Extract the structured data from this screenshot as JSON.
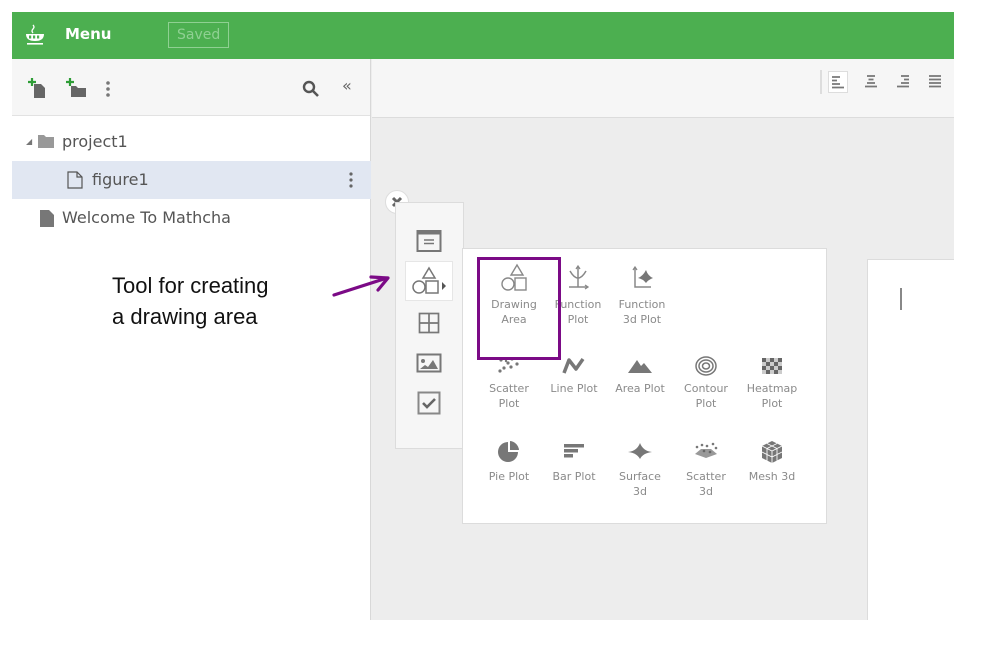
{
  "topbar": {
    "logo_icon": "coffee-cup-icon",
    "menu_label": "Menu",
    "saved_label": "Saved",
    "accent_color": "#4caf50"
  },
  "sidebar": {
    "toolbar": {
      "icons": [
        "new-file-icon",
        "new-folder-icon",
        "more-vertical-icon",
        "search-icon",
        "collapse-double-left-icon"
      ]
    },
    "tree": [
      {
        "label": "project1",
        "type": "folder",
        "expanded": true
      },
      {
        "label": "figure1",
        "type": "file",
        "selected": true
      },
      {
        "label": "Welcome To Mathcha",
        "type": "file"
      }
    ]
  },
  "editor_toolbar": {
    "align_buttons": [
      "align-left",
      "align-center",
      "align-right",
      "align-justify"
    ],
    "active": "align-left"
  },
  "insert_tools": {
    "items": [
      "text-block-icon",
      "shapes-icon",
      "table-icon",
      "image-icon",
      "checkbox-icon"
    ],
    "active": "shapes-icon"
  },
  "plot_menu": {
    "items": [
      {
        "label": "Drawing\nArea",
        "line1": "Drawing",
        "line2": "Area"
      },
      {
        "line1": "Function",
        "line2": "Plot"
      },
      {
        "line1": "Function",
        "line2": "3d Plot"
      },
      {
        "line1": "Scatter",
        "line2": "Plot"
      },
      {
        "line1": "Line Plot",
        "line2": ""
      },
      {
        "line1": "Area Plot",
        "line2": ""
      },
      {
        "line1": "Contour",
        "line2": "Plot"
      },
      {
        "line1": "Heatmap",
        "line2": "Plot"
      },
      {
        "line1": "Pie Plot",
        "line2": ""
      },
      {
        "line1": "Bar Plot",
        "line2": ""
      },
      {
        "line1": "Surface",
        "line2": "3d"
      },
      {
        "line1": "Scatter",
        "line2": "3d"
      },
      {
        "line1": "Mesh 3d",
        "line2": ""
      }
    ],
    "highlight_color": "#7b0a86"
  },
  "annotation": {
    "line1": "Tool for creating",
    "line2": "a drawing area"
  }
}
